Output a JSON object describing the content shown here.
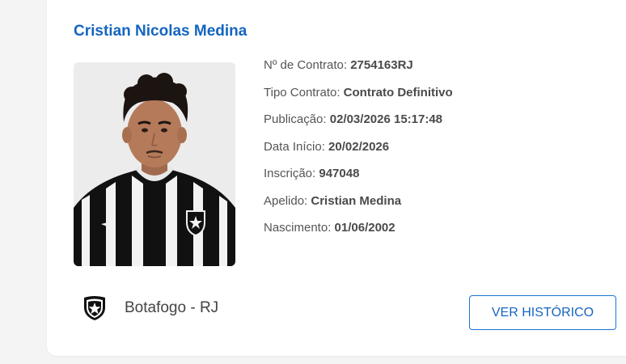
{
  "player": {
    "name": "Cristian Nicolas Medina",
    "photo_alt": "Cristian Nicolas Medina"
  },
  "contract": {
    "numero_label": "Nº de Contrato:",
    "numero_value": "2754163RJ",
    "tipo_label": "Tipo Contrato:",
    "tipo_value": "Contrato Definitivo",
    "publicacao_label": "Publicação:",
    "publicacao_value": "02/03/2026 15:17:48",
    "inicio_label": "Data Início:",
    "inicio_value": "20/02/2026",
    "inscricao_label": "Inscrição:",
    "inscricao_value": "947048",
    "apelido_label": "Apelido:",
    "apelido_value": "Cristian Medina",
    "nascimento_label": "Nascimento:",
    "nascimento_value": "01/06/2002"
  },
  "club": {
    "name": "Botafogo - RJ",
    "icon": "botafogo-shield-icon"
  },
  "actions": {
    "history_label": "VER HISTÓRICO"
  },
  "colors": {
    "accent": "#1565c0",
    "text": "#555555",
    "background": "#f4f4f5",
    "card": "#ffffff"
  }
}
